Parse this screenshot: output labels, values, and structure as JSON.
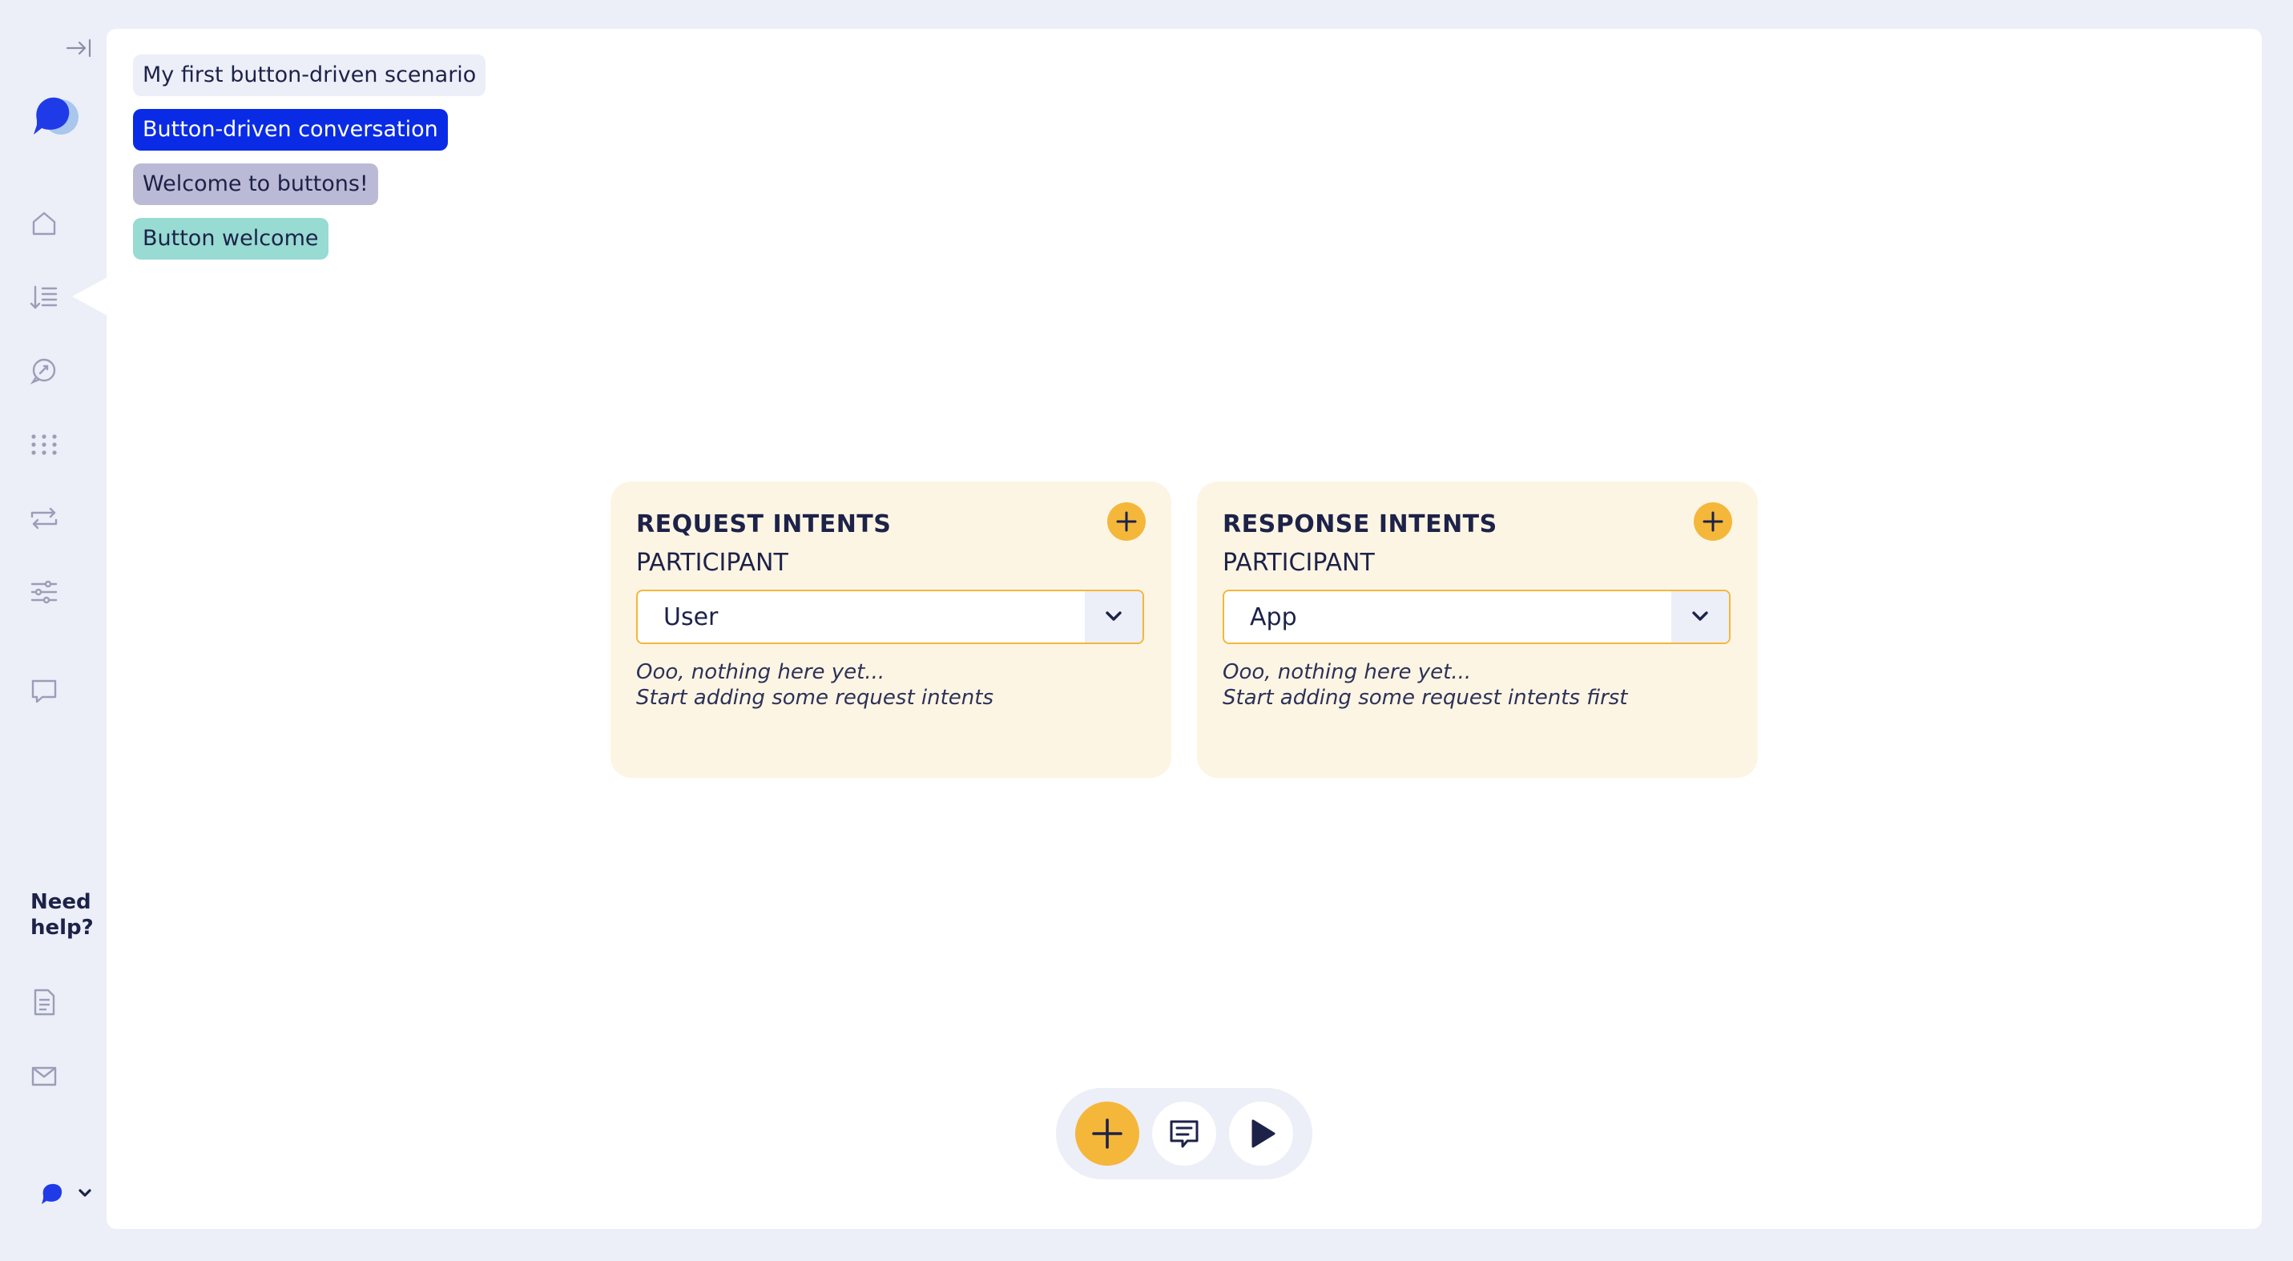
{
  "colors": {
    "accent_yellow": "#f4b73a",
    "brand_blue": "#0a2be6",
    "text_dark": "#1d2248",
    "card_bg": "#fdf5e4",
    "app_bg": "#eceef8"
  },
  "sidebar": {
    "collapse_icon": "collapse-arrow-icon",
    "logo": "chat-bubble-logo",
    "nav": [
      {
        "icon": "home-icon"
      },
      {
        "icon": "conversations-list-icon",
        "active": true
      },
      {
        "icon": "search-message-icon"
      },
      {
        "icon": "grid-dots-icon"
      },
      {
        "icon": "swap-arrows-icon"
      },
      {
        "icon": "sliders-icon"
      },
      {
        "icon": "chat-icon"
      }
    ],
    "need_help": "Need help?",
    "help_links": [
      {
        "icon": "document-icon"
      },
      {
        "icon": "mail-icon"
      }
    ]
  },
  "breadcrumbs": {
    "scenario": "My first button-driven scenario",
    "conversation": "Button-driven conversation",
    "scene": "Welcome to buttons!",
    "turn": "Button welcome"
  },
  "request_card": {
    "title": "REQUEST INTENTS",
    "participant_label": "PARTICIPANT",
    "participant_value": "User",
    "empty_line1": "Ooo, nothing here yet...",
    "empty_line2": "Start adding some request intents"
  },
  "response_card": {
    "title": "RESPONSE INTENTS",
    "participant_label": "PARTICIPANT",
    "participant_value": "App",
    "empty_line1": "Ooo, nothing here yet...",
    "empty_line2": "Start adding some request intents first"
  },
  "toolbar": {
    "buttons": [
      "add-icon",
      "message-preview-icon",
      "play-icon"
    ]
  }
}
